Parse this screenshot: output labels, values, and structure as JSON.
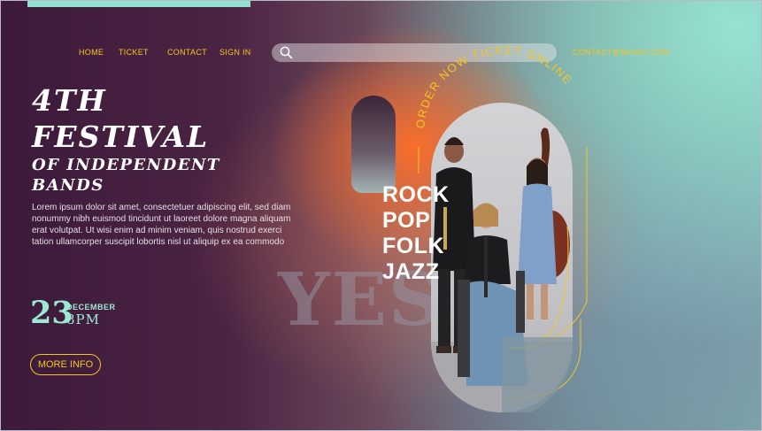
{
  "nav": {
    "home": "HOME",
    "ticket": "TICKET",
    "contact": "CONTACT",
    "signin": "SIGN IN",
    "email": "CONTACT@MUSIC.COM"
  },
  "search": {
    "placeholder": ""
  },
  "hero": {
    "title_line1": "4TH",
    "title_line2": "FESTIVAL",
    "title_line3": "OF INDEPENDENT",
    "title_line4": "BANDS",
    "description": "Lorem ipsum dolor sit amet, consectetuer adipiscing elit, sed diam nonummy nibh euismod tincidunt ut laoreet dolore magna aliquam erat volutpat. Ut wisi enim ad minim veniam, quis nostrud exerci tation ullamcorper suscipit lobortis nisl ut aliquip ex ea commodo"
  },
  "date": {
    "day": "23",
    "month": "DECEMBER",
    "time": "8PM"
  },
  "cta": {
    "more_info": "MORE INFO"
  },
  "curved_text": "ORDER NOW TICKET ONLINE",
  "background_word": "YES",
  "genres": [
    "ROCK",
    "POP",
    "FOLK",
    "JAZZ"
  ],
  "colors": {
    "accent": "#f3c623",
    "mint": "#9de8d2",
    "plum": "#3d1a3a",
    "orange": "#ff6e28"
  }
}
